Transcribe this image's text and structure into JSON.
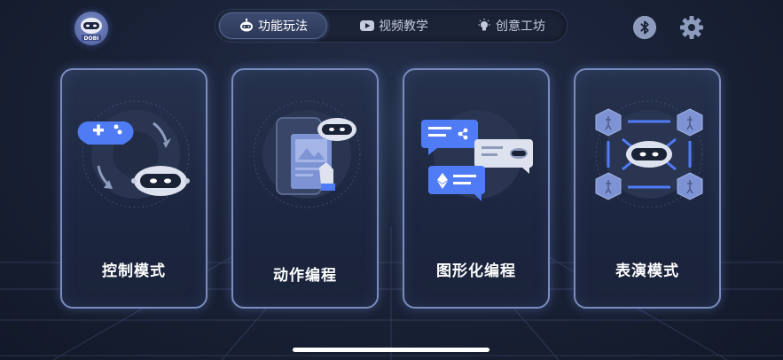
{
  "brand": {
    "logo_text": "DOBI"
  },
  "tabs": [
    {
      "label": "功能玩法",
      "icon": "robot-icon",
      "active": true
    },
    {
      "label": "视频教学",
      "icon": "video-play-icon",
      "active": false
    },
    {
      "label": "创意工坊",
      "icon": "lightbulb-icon",
      "active": false
    }
  ],
  "toolbar": {
    "bluetooth_icon": "bluetooth-icon",
    "settings_icon": "gear-icon"
  },
  "cards": [
    {
      "label": "控制模式",
      "icon": "gamepad-robot-icon"
    },
    {
      "label": "动作编程",
      "icon": "phone-robot-icon"
    },
    {
      "label": "图形化编程",
      "icon": "chat-bubbles-icon"
    },
    {
      "label": "表演模式",
      "icon": "cube-network-icon"
    }
  ],
  "colors": {
    "accent": "#4f7cf5",
    "card_border": "#7a8cc0",
    "background": "#1a2338"
  }
}
